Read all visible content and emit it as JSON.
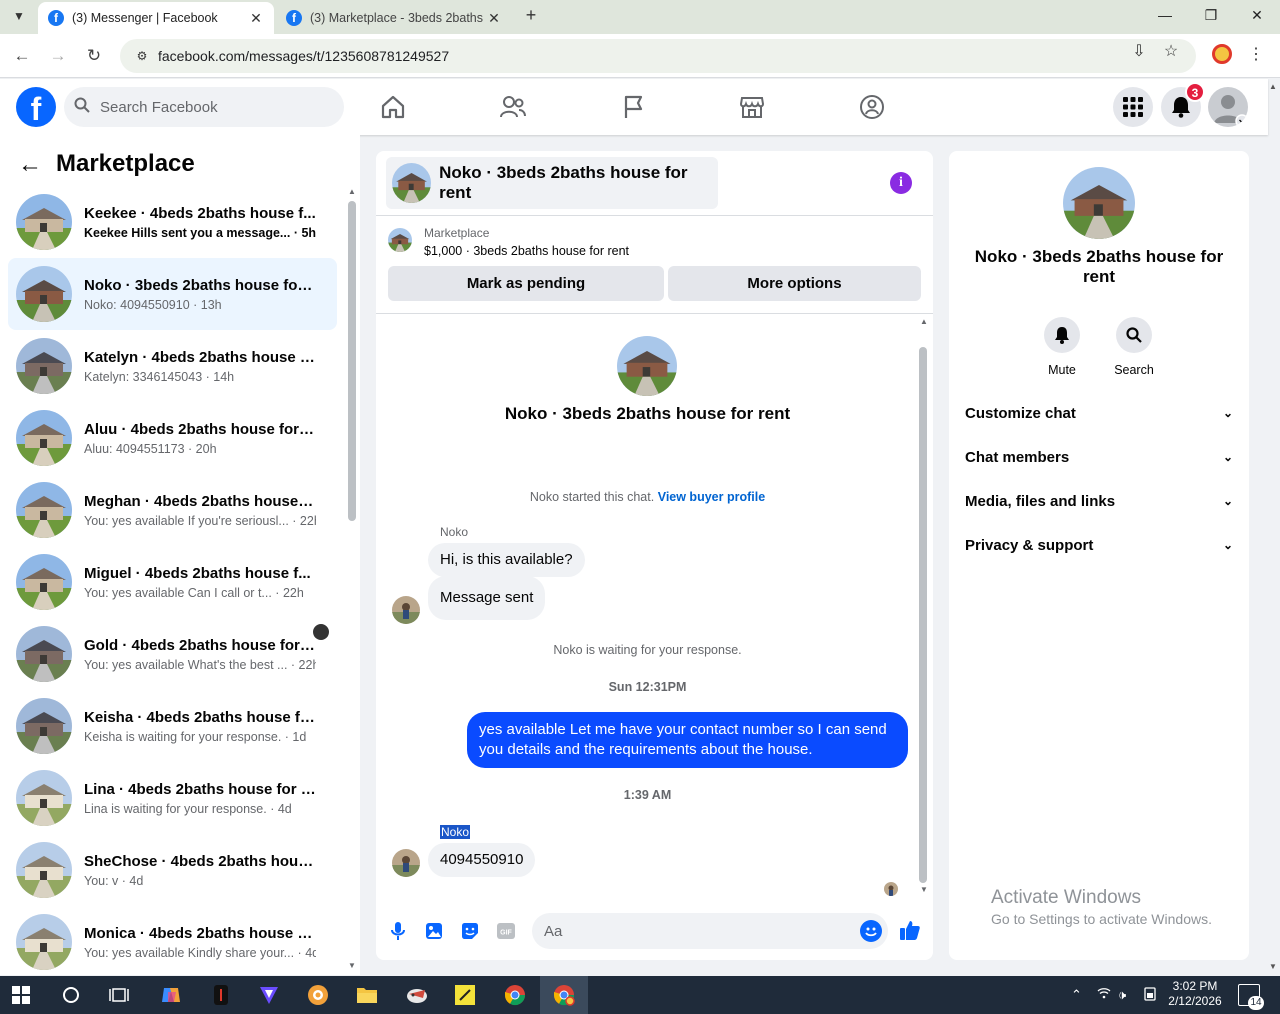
{
  "browser": {
    "tabs": [
      {
        "title": "(3) Messenger | Facebook",
        "active": true
      },
      {
        "title": "(3) Marketplace - 3beds 2baths",
        "active": false
      }
    ],
    "url": "facebook.com/messages/t/1235608781249527"
  },
  "header": {
    "search_placeholder": "Search Facebook",
    "notification_count": "3",
    "colors": {
      "brand": "#0866ff",
      "badge": "#e41e3f"
    }
  },
  "sidebar": {
    "title": "Marketplace",
    "conversations": [
      {
        "name": "Keekee · 4beds 2baths house f...",
        "snippet": "Keekee Hills sent you a message... · 5h",
        "unread": true,
        "thumb": "green"
      },
      {
        "name": "Noko · 3beds 2baths house for r...",
        "snippet": "Noko: 4094550910 · 13h",
        "active": true,
        "thumb": "brick"
      },
      {
        "name": "Katelyn · 4beds 2baths house fo...",
        "snippet": "Katelyn: 3346145043 · 14h",
        "thumb": "gray"
      },
      {
        "name": "Aluu · 4beds 2baths house for re...",
        "snippet": "Aluu: 4094551173 · 20h",
        "thumb": "green"
      },
      {
        "name": "Meghan · 4beds 2baths house f...",
        "snippet": "You: yes available If you're seriousl... · 22h",
        "thumb": "green"
      },
      {
        "name": "Miguel · 4beds 2baths house f...",
        "snippet": "You: yes available Can I call or t... · 22h",
        "thumb": "green"
      },
      {
        "name": "Gold · 4beds 2baths house for r...",
        "snippet": "You: yes available What's the best ... · 22h",
        "thumb": "gray"
      },
      {
        "name": "Keisha · 4beds 2baths house for ...",
        "snippet": "Keisha is waiting for your response. · 1d",
        "thumb": "gray"
      },
      {
        "name": "Lina · 4beds 2baths house for rent",
        "snippet": "Lina is waiting for your response. · 4d",
        "thumb": "cream"
      },
      {
        "name": "SheChose · 4beds 2baths house ...",
        "snippet": "You: v · 4d",
        "thumb": "cream"
      },
      {
        "name": "Monica · 4beds 2baths house fo...",
        "snippet": "You: yes available Kindly share your... · 4d",
        "thumb": "cream"
      }
    ]
  },
  "chat": {
    "title": "Noko · 3beds 2baths house for rent",
    "marketplace_label": "Marketplace",
    "listing": "$1,000 · 3beds 2baths house for rent",
    "mark_pending": "Mark as pending",
    "more_options": "More options",
    "intro_title": "Noko · 3beds 2baths house for rent",
    "started_text": "Noko started this chat.",
    "view_profile": "View buyer profile",
    "sender1": "Noko",
    "msg1": "Hi, is this available?",
    "msg2": "Message sent",
    "waiting": "Noko is waiting for your response.",
    "ts1": "Sun 12:31PM",
    "out_msg": "yes available Let me have your contact number so I can send you details and the requirements about the house.",
    "ts2": "1:39 AM",
    "sender2": "Noko",
    "msg3": "4094550910",
    "input_placeholder": "Aa"
  },
  "right_panel": {
    "title": "Noko · 3beds 2baths house for rent",
    "mute": "Mute",
    "search": "Search",
    "sections": [
      "Customize chat",
      "Chat members",
      "Media, files and links",
      "Privacy & support"
    ]
  },
  "watermark": {
    "line1": "Activate Windows",
    "line2": "Go to Settings to activate Windows."
  },
  "taskbar": {
    "time": "3:02 PM",
    "date": "2/12/2026",
    "notif_count": "14"
  }
}
